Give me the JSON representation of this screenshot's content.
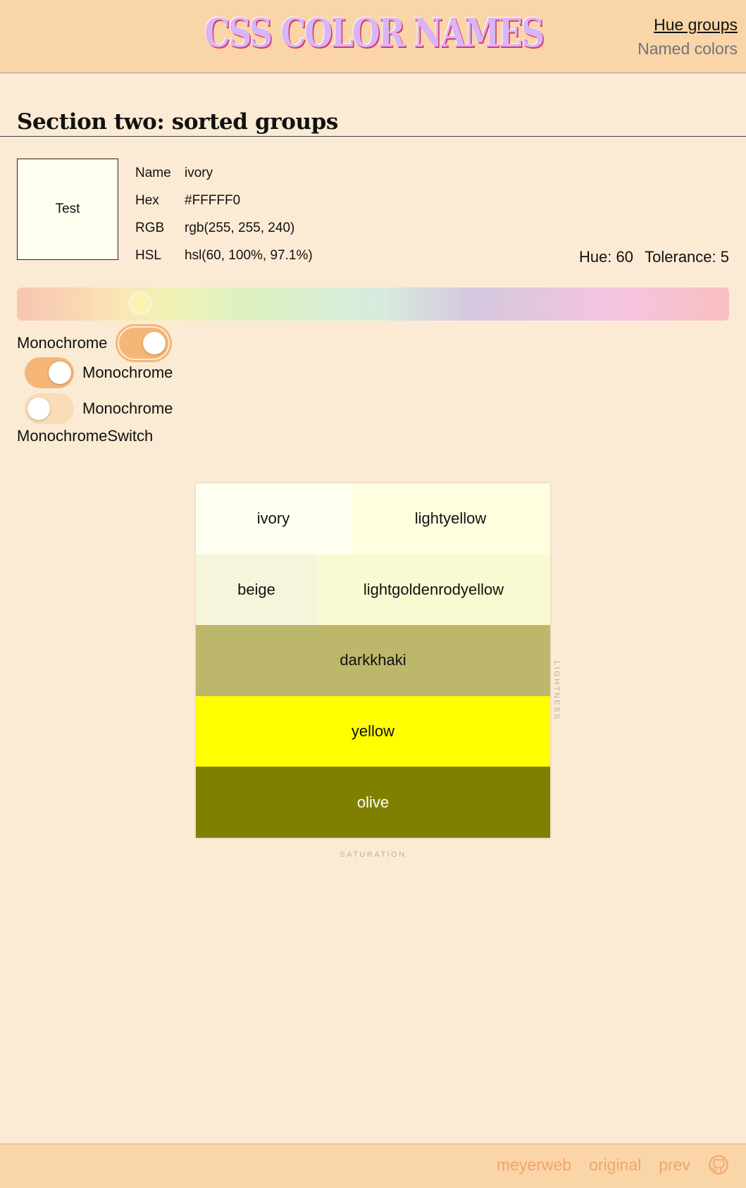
{
  "header": {
    "title": "CSS COLOR NAMES",
    "nav": [
      "Hue groups",
      "Named colors"
    ]
  },
  "section": {
    "title": "Section two: sorted groups"
  },
  "swatch": {
    "label": "Test",
    "color": "#FFFFF0"
  },
  "info": {
    "rows": [
      {
        "key": "Name",
        "value": "ivory"
      },
      {
        "key": "Hex",
        "value": "#FFFFF0"
      },
      {
        "key": "RGB",
        "value": "rgb(255, 255, 240)"
      },
      {
        "key": "HSL",
        "value": "hsl(60, 100%, 97.1%)"
      }
    ]
  },
  "readout": {
    "hue": "Hue: 60",
    "tolerance": "Tolerance: 5"
  },
  "slider": {
    "hue_value": 60,
    "hue_max": 360
  },
  "toggles": {
    "first": {
      "label": "Monochrome",
      "state": "on"
    },
    "second": {
      "label": "Monochrome",
      "state": "on"
    },
    "third": {
      "label": "Monochrome",
      "state": "off"
    },
    "switch_label": "MonochromeSwitch"
  },
  "grid": {
    "rows": [
      [
        {
          "name": "ivory",
          "color": "#FFFFF0"
        },
        {
          "name": "lightyellow",
          "color": "#FFFFE0"
        }
      ],
      [
        {
          "name": "beige",
          "color": "#F5F5DC"
        },
        {
          "name": "lightgoldenrodyellow",
          "color": "#FAFAD2"
        }
      ],
      [
        {
          "name": "darkkhaki",
          "color": "#BDB76B"
        }
      ],
      [
        {
          "name": "yellow",
          "color": "#FFFF00"
        }
      ],
      [
        {
          "name": "olive",
          "color": "#808000",
          "text_color": "#FFFFFF"
        }
      ]
    ],
    "axis_y": "LIGHTNESS",
    "axis_x": "SATURATION"
  },
  "footer": {
    "links": [
      "meyerweb",
      "original",
      "prev"
    ]
  },
  "colors": {
    "header_bg": "#F9D5A8",
    "page_bg": "#FCEBD4",
    "accent": "#F5B678",
    "footer_link": "#F2A56A"
  }
}
